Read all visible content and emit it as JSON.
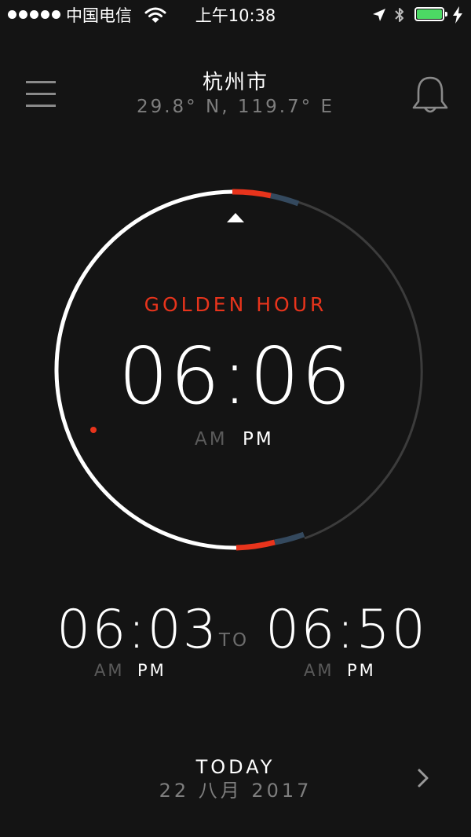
{
  "status_bar": {
    "carrier": "中国电信",
    "time": "上午10:38",
    "battery_color": "#4cd964",
    "icons": [
      "signal-dots",
      "wifi-icon",
      "location-arrow-icon",
      "bluetooth-icon",
      "battery-icon",
      "charging-bolt-icon"
    ]
  },
  "header": {
    "city": "杭州市",
    "coordinates": "29.8° N, 119.7° E",
    "menu_icon": "hamburger-menu-icon",
    "bell_icon": "bell-icon"
  },
  "dial": {
    "phase": "GOLDEN HOUR",
    "current_time": "06:06",
    "am": "AM",
    "pm": "PM",
    "active_period": "PM",
    "accent_color": "#e8341c",
    "secondary_color": "#34495e"
  },
  "range": {
    "start_time": "06:03",
    "start_am": "AM",
    "start_pm": "PM",
    "connector": "TO",
    "end_time": "06:50",
    "end_am": "AM",
    "end_pm": "PM"
  },
  "footer": {
    "day": "TODAY",
    "date": "22 八月 2017",
    "next_icon": "chevron-right-icon"
  }
}
